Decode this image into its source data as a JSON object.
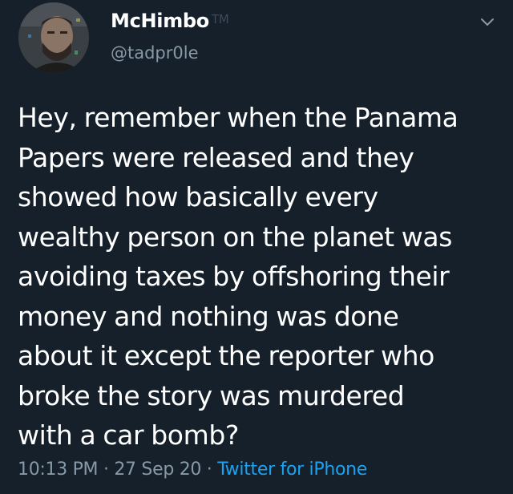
{
  "author": {
    "display_name": "McHimbo",
    "tm": "TM",
    "handle": "@tadpr0le",
    "avatar_icon": "profile-photo"
  },
  "menu_icon": "chevron-down-icon",
  "tweet": {
    "text": "Hey, remember when the Panama Papers were released and they showed how basically every wealthy person on the planet was avoiding taxes by offshoring their money and nothing was done about it except the reporter who broke the story was murdered with a car bomb?",
    "lines": [
      "Hey, remember when the Panama",
      "Papers were released and they",
      "showed how basically every",
      "wealthy person on the planet was",
      "avoiding taxes by offshoring their",
      "money and nothing was done",
      "about it except the reporter who",
      "broke the story was murdered",
      "with a car bomb?"
    ]
  },
  "meta": {
    "time": "10:13 PM",
    "separator": " · ",
    "date": "27 Sep 20",
    "source": "Twitter for iPhone"
  },
  "colors": {
    "background": "#15202b",
    "text": "#ffffff",
    "secondary": "#8899a6",
    "link": "#1da1f2"
  }
}
